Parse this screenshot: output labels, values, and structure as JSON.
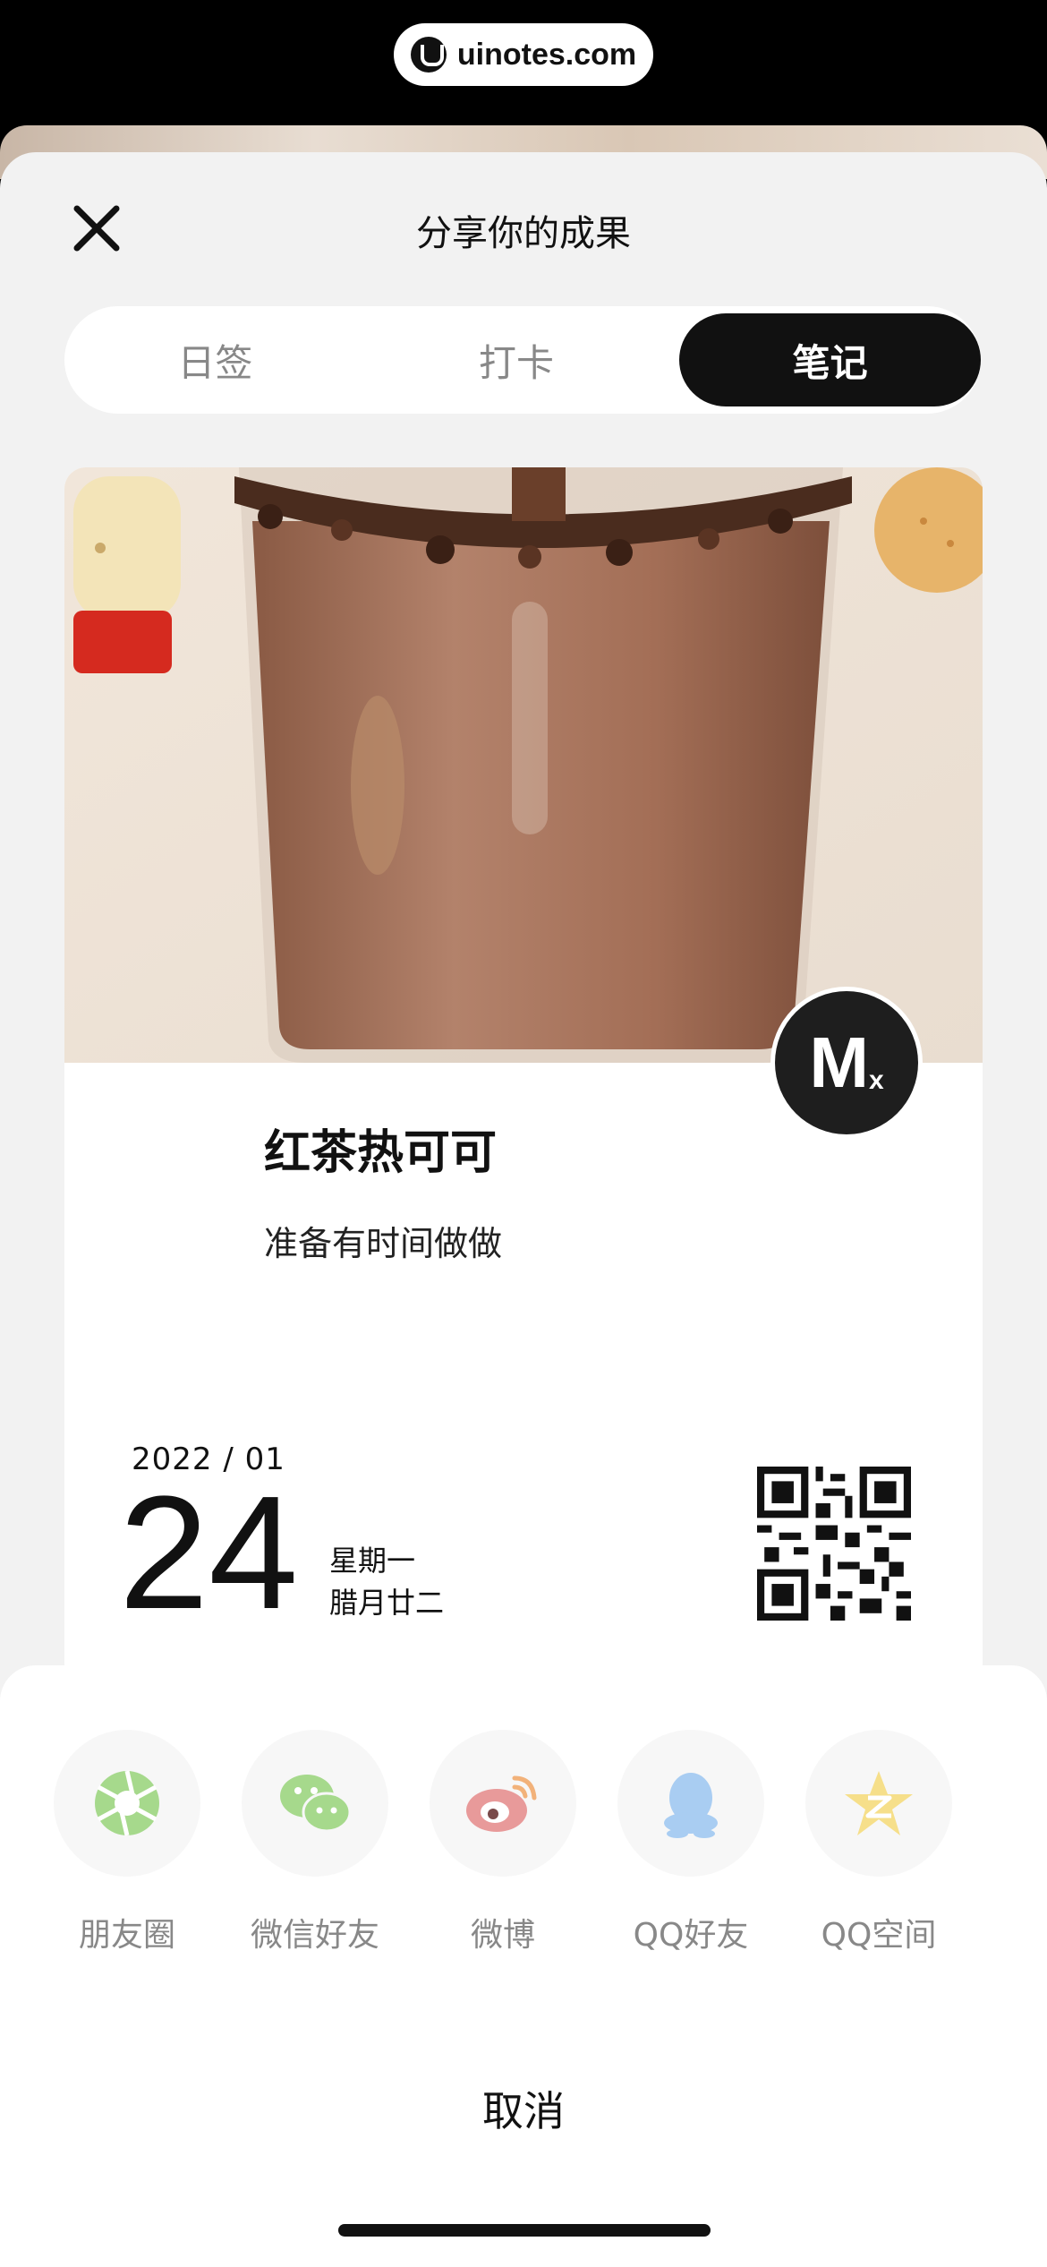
{
  "watermark": {
    "text": "uinotes.com"
  },
  "header": {
    "title": "分享你的成果",
    "close_icon": "close-icon"
  },
  "tabs": [
    {
      "label": "日签",
      "active": false
    },
    {
      "label": "打卡",
      "active": false
    },
    {
      "label": "笔记",
      "active": true
    }
  ],
  "card": {
    "recipe_title": "红茶热可可",
    "note": "准备有时间做做",
    "date": {
      "year_month": "2022 / 01",
      "day": "24",
      "weekday": "星期一",
      "lunar": "腊月廿二"
    },
    "badge_icon": "app-logo-icon",
    "qr_icon": "qr-code-icon"
  },
  "share": {
    "items": [
      {
        "label": "朋友圈",
        "icon": "moments-icon",
        "color": "#a6d98c"
      },
      {
        "label": "微信好友",
        "icon": "wechat-icon",
        "color": "#a6d98c"
      },
      {
        "label": "微博",
        "icon": "weibo-icon",
        "color": "#e89a9a"
      },
      {
        "label": "QQ好友",
        "icon": "qq-icon",
        "color": "#a9cdf2"
      },
      {
        "label": "QQ空间",
        "icon": "qzone-icon",
        "color": "#f6df8a"
      }
    ],
    "cancel_label": "取消"
  }
}
